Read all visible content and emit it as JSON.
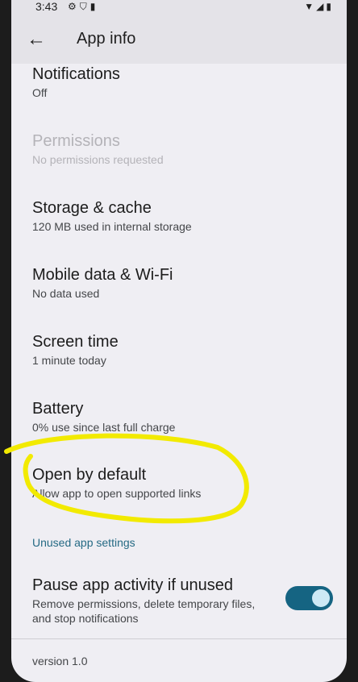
{
  "status_bar": {
    "time": "3:43",
    "icons": [
      "gear-icon",
      "shield-icon",
      "sim-icon"
    ],
    "right_icons": [
      "wifi-icon",
      "signal-icon",
      "battery-icon"
    ]
  },
  "app_bar": {
    "title": "App info"
  },
  "items": [
    {
      "title": "Notifications",
      "subtitle": "Off",
      "enabled": true
    },
    {
      "title": "Permissions",
      "subtitle": "No permissions requested",
      "enabled": false
    },
    {
      "title": "Storage & cache",
      "subtitle": "120 MB used in internal storage",
      "enabled": true
    },
    {
      "title": "Mobile data & Wi‑Fi",
      "subtitle": "No data used",
      "enabled": true
    },
    {
      "title": "Screen time",
      "subtitle": "1 minute today",
      "enabled": true
    },
    {
      "title": "Battery",
      "subtitle": "0% use since last full charge",
      "enabled": true
    },
    {
      "title": "Open by default",
      "subtitle": "Allow app to open supported links",
      "enabled": true
    }
  ],
  "unused_section": {
    "header": "Unused app settings",
    "pause_title": "Pause app activity if unused",
    "pause_subtitle_line1": "Remove permissions, delete temporary files,",
    "pause_subtitle_line2": "and stop notifications",
    "pause_enabled": true
  },
  "version": "version 1.0",
  "colors": {
    "accent": "#156482",
    "highlight": "#f2ea00",
    "background": "#efeef3"
  }
}
